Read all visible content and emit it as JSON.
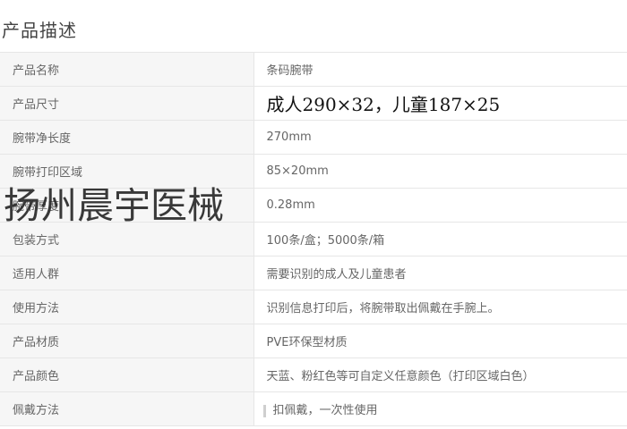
{
  "page": {
    "title": "产品描述"
  },
  "specs": [
    {
      "label": "产品名称",
      "value": "条码腕带"
    },
    {
      "label": "产品尺寸",
      "value": "成人290×32，儿童187×25"
    },
    {
      "label": "腕带净长度",
      "value": "270mm"
    },
    {
      "label": "腕带打印区域",
      "value": "85×20mm"
    },
    {
      "label": "腕带厚度",
      "value": "0.28mm"
    },
    {
      "label": "包装方式",
      "value": "100条/盒；5000条/箱"
    },
    {
      "label": "适用人群",
      "value": "需要识别的成人及儿童患者"
    },
    {
      "label": "使用方法",
      "value": "识别信息打印后，将腕带取出佩戴在手腕上。"
    },
    {
      "label": "产品材质",
      "value": "PVE环保型材质"
    },
    {
      "label": "产品颜色",
      "value": "天蓝、粉红色等可自定义任意颜色（打印区域白色）"
    },
    {
      "label": "佩戴方法",
      "value": "扣佩戴，一次性使用"
    }
  ],
  "watermark": {
    "text": "扬州晨宇医械"
  }
}
